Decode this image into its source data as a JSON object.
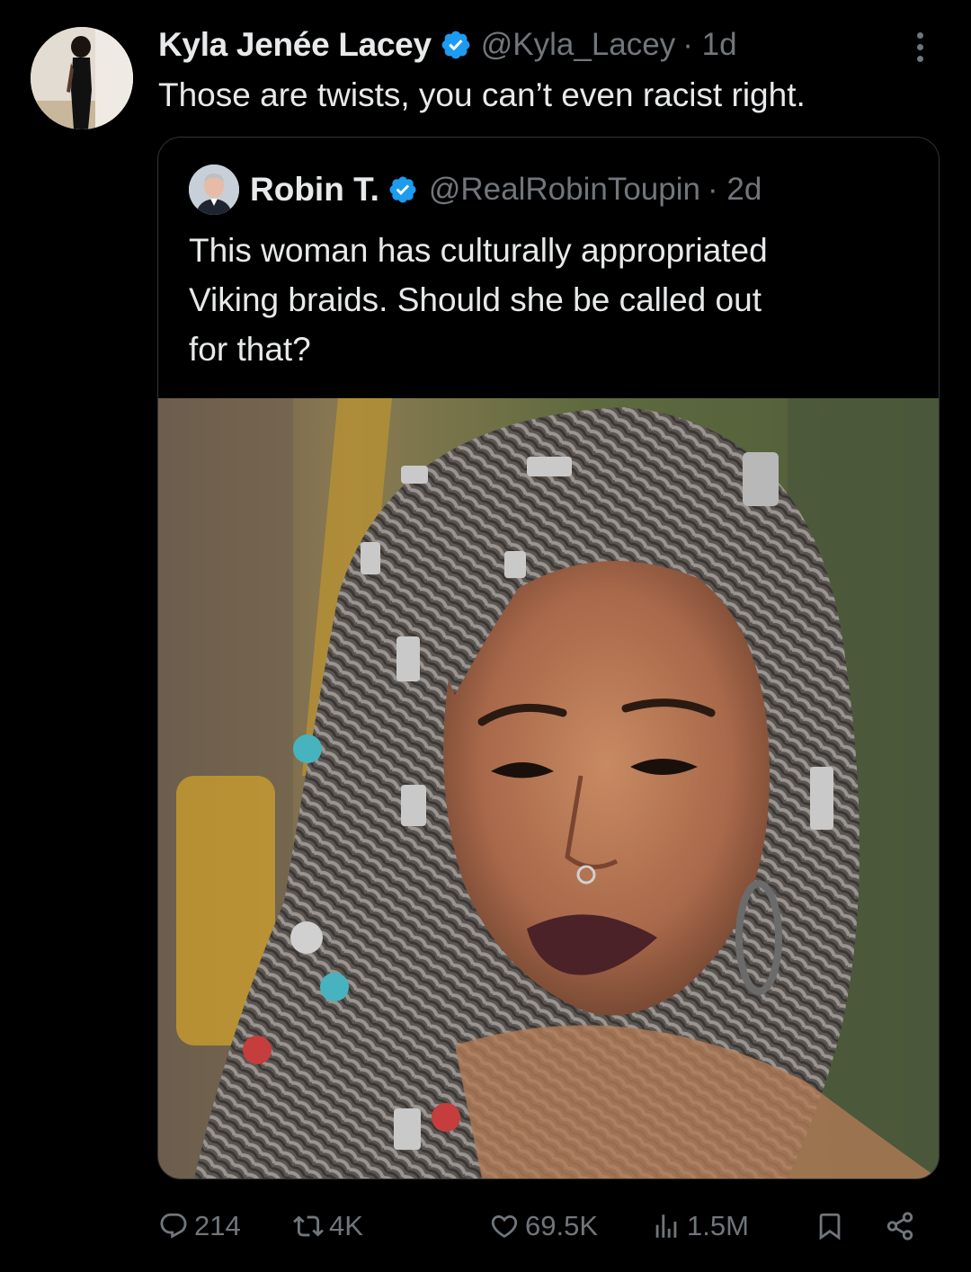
{
  "post": {
    "author": {
      "display_name": "Kyla Jenée Lacey",
      "handle": "@Kyla_Lacey",
      "time": "· 1d"
    },
    "text": "Those are twists, you can’t even racist right."
  },
  "quoted_post": {
    "author": {
      "display_name": "Robin T.",
      "handle": "@RealRobinToupin",
      "time": "· 2d"
    },
    "text_lines": [
      "This woman has culturally appropriated",
      "Viking braids. Should she be called out",
      "for that?"
    ]
  },
  "actions": {
    "replies": "214",
    "reposts": "4K",
    "likes": "69.5K",
    "views": "1.5M"
  },
  "icons": {
    "more": "more-vertical-icon",
    "verified": "verified-badge-icon",
    "reply": "reply-icon",
    "repost": "repost-icon",
    "like": "heart-icon",
    "views": "views-chart-icon",
    "bookmark": "bookmark-icon",
    "share": "share-icon"
  },
  "colors": {
    "background": "#000000",
    "text": "#e7e9ea",
    "secondary": "#71767b",
    "verified": "#1d9bf0",
    "border": "#2f3336"
  }
}
